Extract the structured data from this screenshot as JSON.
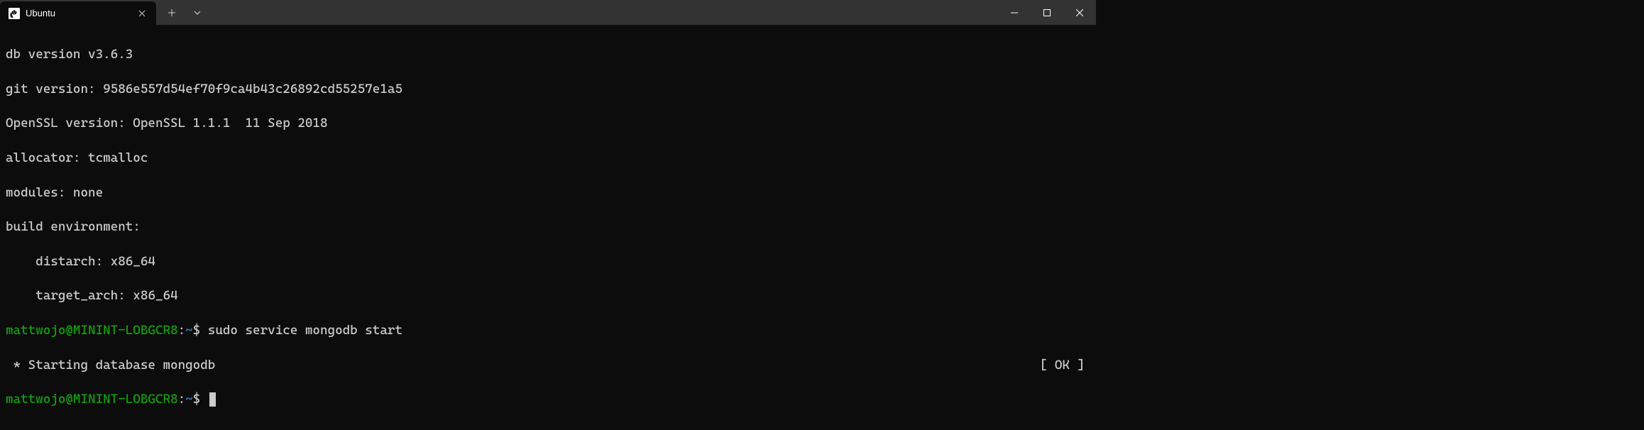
{
  "titlebar": {
    "tab": {
      "title": "Ubuntu"
    }
  },
  "terminal": {
    "lines": {
      "db_version": "db version v3.6.3",
      "git_version": "git version: 9586e557d54ef70f9ca4b43c26892cd55257e1a5",
      "openssl_version": "OpenSSL version: OpenSSL 1.1.1  11 Sep 2018",
      "allocator": "allocator: tcmalloc",
      "modules": "modules: none",
      "build_env": "build environment:",
      "distarch": "    distarch: x86_64",
      "target_arch": "    target_arch: x86_64"
    },
    "prompt1": {
      "user": "mattwojo@MININT-LOBGCR8",
      "colon": ":",
      "path": "~",
      "dollar": "$ ",
      "command": "sudo service mongodb start"
    },
    "status": {
      "left": " * Starting database mongodb",
      "right": "[ OK ]"
    },
    "prompt2": {
      "user": "mattwojo@MININT-LOBGCR8",
      "colon": ":",
      "path": "~",
      "dollar": "$ "
    }
  }
}
